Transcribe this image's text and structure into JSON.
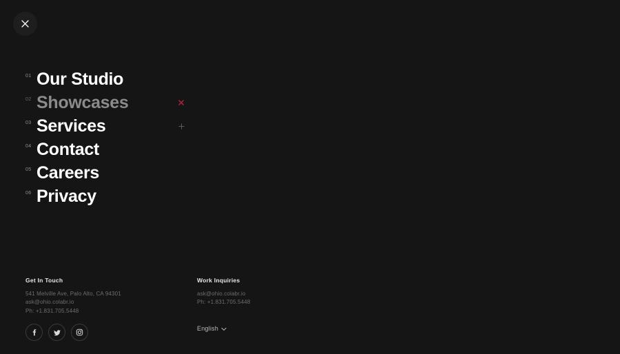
{
  "theme": {
    "background": "#151515",
    "text_primary": "#ffffff",
    "text_dimmed": "#8b8b8b",
    "text_muted": "#6e6e6e",
    "accent_marker": "#a3203a"
  },
  "close_button": {
    "icon": "close-icon",
    "label": "Close"
  },
  "nav": {
    "items": [
      {
        "index": "01",
        "label": "Our Studio",
        "state": "default",
        "marker": null
      },
      {
        "index": "02",
        "label": "Showcases",
        "state": "dimmed",
        "marker": "cross-marker"
      },
      {
        "index": "03",
        "label": "Services",
        "state": "default",
        "marker": "plus-marker"
      },
      {
        "index": "04",
        "label": "Contact",
        "state": "default",
        "marker": null
      },
      {
        "index": "05",
        "label": "Careers",
        "state": "default",
        "marker": null
      },
      {
        "index": "06",
        "label": "Privacy",
        "state": "default",
        "marker": null
      }
    ]
  },
  "footer": {
    "get_in_touch": {
      "heading": "Get In Touch",
      "address": "541 Melville Ave, Palo Alto, CA 94301",
      "email": "ask@ohio.colabr.io",
      "phone": "Ph: +1.831.705.5448"
    },
    "work_inquiries": {
      "heading": "Work Inquiries",
      "email": "ask@ohio.colabr.io",
      "phone": "Ph: +1.831.705.5448"
    },
    "socials": [
      {
        "name": "facebook",
        "label": "Facebook"
      },
      {
        "name": "twitter",
        "label": "Twitter"
      },
      {
        "name": "instagram",
        "label": "Instagram"
      }
    ],
    "language": {
      "selected": "English",
      "icon": "chevron-down-icon"
    }
  }
}
